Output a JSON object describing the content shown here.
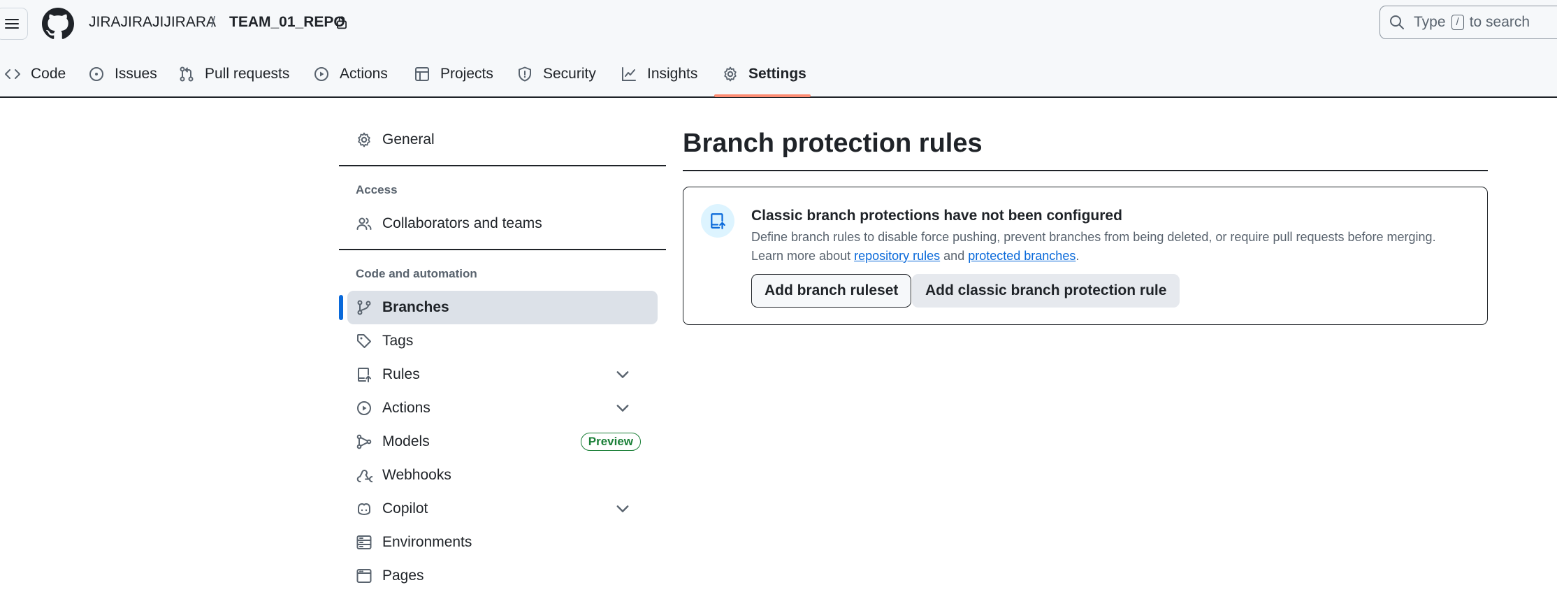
{
  "header": {
    "owner": "JIRAJIRAJIJIRARA",
    "separator": "/",
    "repo": "TEAM_01_REPO",
    "search": {
      "prefix": "Type",
      "key": "/",
      "suffix": "to search"
    }
  },
  "tabs": [
    {
      "label": "Code"
    },
    {
      "label": "Issues"
    },
    {
      "label": "Pull requests"
    },
    {
      "label": "Actions"
    },
    {
      "label": "Projects"
    },
    {
      "label": "Security"
    },
    {
      "label": "Insights"
    },
    {
      "label": "Settings"
    }
  ],
  "sidebar": {
    "general": "General",
    "access_heading": "Access",
    "collaborators": "Collaborators and teams",
    "code_heading": "Code and automation",
    "items": [
      {
        "label": "Branches"
      },
      {
        "label": "Tags"
      },
      {
        "label": "Rules"
      },
      {
        "label": "Actions"
      },
      {
        "label": "Models",
        "badge": "Preview"
      },
      {
        "label": "Webhooks"
      },
      {
        "label": "Copilot"
      },
      {
        "label": "Environments"
      },
      {
        "label": "Pages"
      }
    ]
  },
  "main": {
    "title": "Branch protection rules",
    "blankslate": {
      "title": "Classic branch protections have not been configured",
      "desc_line1": "Define branch rules to disable force pushing, prevent branches from being deleted, or require pull requests before merging.",
      "desc_prefix": "Learn more about",
      "link1": "repository rules",
      "desc_and": "and",
      "link2": "protected branches",
      "desc_end": ".",
      "button_ruleset": "Add branch ruleset",
      "button_classic": "Add classic branch protection rule"
    }
  },
  "colors": {
    "accent": "#0969da",
    "active_tab_underline": "#fd8c73",
    "preview_badge": "#1a7f37"
  }
}
